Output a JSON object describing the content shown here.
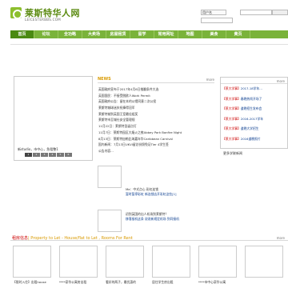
{
  "header": {
    "site_title": "莱斯特华人网",
    "site_url": "LEICESTERBBS.COM",
    "search_select": "用户名"
  },
  "nav": {
    "items": [
      "首页",
      "论坛",
      "全功略",
      "大卖场",
      "房屋租赁",
      "留学",
      "常用网址",
      "地图",
      "美食",
      "黄页"
    ]
  },
  "slideshow": {
    "caption": "新studio，市中心，急租整1",
    "dots": [
      "1",
      "2",
      "3",
      "4",
      "5",
      "6"
    ]
  },
  "news": {
    "title": "NEWS",
    "more": "more",
    "items": [
      "英国政府宣布于2017年4月6日推翻条件大选",
      "英国国民：不接受脱欧人Work Permit",
      "英国政府公告：留在本的公馆同意二次公投",
      "莱斯特城球迷庆祝捧得冠军",
      "莱斯特城到英国王室最佳组奖",
      "莱斯特市至城社安全管理规",
      "11月22日：莱斯特圣诞点灯",
      "11月7日：莱斯特园区大烟火之夜Abbey Park Bonfire Night",
      "8月13日：莱斯特加勒比海嘉年华Caribbean Carnival",
      "国内新闻：7月13日UKVI留总份照免证Tier 4学生签",
      "公告内容..."
    ]
  },
  "sidebar": {
    "more": "more",
    "items": [
      {
        "tag": "【莱大学事】",
        "text": "2017-18学年..."
      },
      {
        "tag": "【莱大学事】",
        "text": "春晚热闹开场了"
      },
      {
        "tag": "【莱大学事】",
        "text": "道晚招生发布会"
      },
      {
        "tag": "【莱大学事】",
        "text": "2016-2017学年"
      },
      {
        "tag": "【莱大学事】",
        "text": "道晚大学招生"
      },
      {
        "tag": "【莱大学事】",
        "text": "2016道晚照片"
      }
    ],
    "footer": "更多学联新闻"
  },
  "promos": [
    {
      "line1": "Me：中式点心 彩虹连锁",
      "line2": "暂时暂停彩虹 新连锁店开彩虹这些[1]"
    },
    {
      "line1": "初到英国的出人机场到莱斯特？",
      "line2": "移落接机这条 说说新规定机场 到同接机"
    }
  ],
  "property": {
    "title_cn": "租房信息",
    "title_en": "| Property to Let - House/flat to Let , Rooms For Rent",
    "more": "more",
    "labels": [
      "【限时入住】出租house",
      "****豪华公寓房出租",
      "看好的两子，最优惠的",
      "居住学生房出租",
      "****市中心豪华公寓"
    ]
  }
}
